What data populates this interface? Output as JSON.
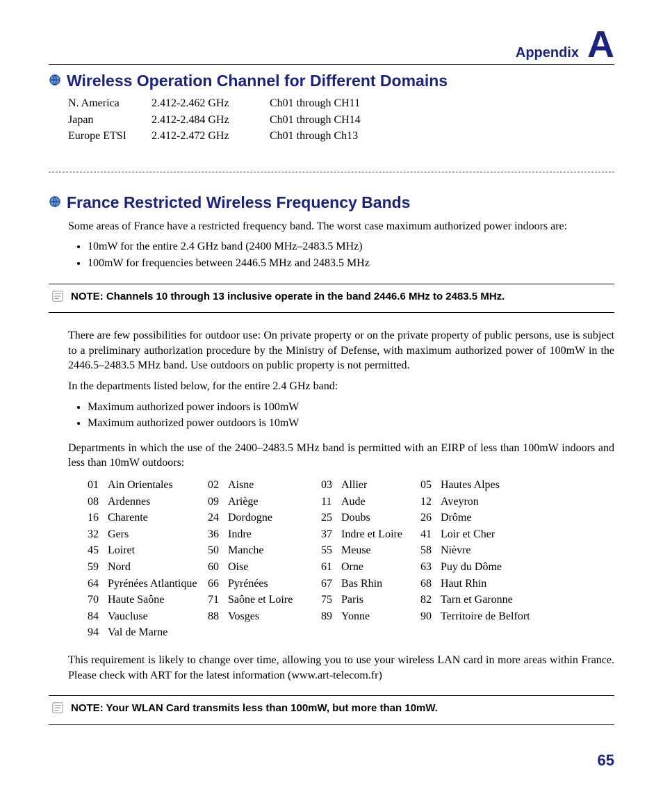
{
  "header": {
    "label": "Appendix",
    "letter": "A"
  },
  "section1": {
    "title": "Wireless Operation Channel for Different Domains",
    "rows": [
      {
        "region": "N. America",
        "freq": "2.412-2.462 GHz",
        "ch": "Ch01 through CH11"
      },
      {
        "region": "Japan",
        "freq": "2.412-2.484 GHz",
        "ch": "Ch01 through CH14"
      },
      {
        "region": "Europe ETSI",
        "freq": "2.412-2.472 GHz",
        "ch": "Ch01 through Ch13"
      }
    ]
  },
  "section2": {
    "title": "France Restricted Wireless Frequency Bands",
    "intro": "Some areas of France have a restricted frequency band. The worst case maximum authorized power indoors are:",
    "intro_bullets": [
      "10mW for the entire 2.4 GHz band (2400 MHz–2483.5 MHz)",
      "100mW for frequencies between 2446.5 MHz and 2483.5 MHz"
    ],
    "note1": "NOTE: Channels 10 through 13 inclusive operate in the band 2446.6 MHz to 2483.5 MHz.",
    "para1": "There are few possibilities for outdoor use: On private property or on the private property of public persons, use is subject to a preliminary authorization procedure by the Ministry of Defense, with maximum authorized power of 100mW in the 2446.5–2483.5 MHz band. Use outdoors on public property is not permitted.",
    "para2": "In the departments listed below, for the entire 2.4 GHz band:",
    "para2_bullets": [
      "Maximum authorized power indoors is 100mW",
      "Maximum authorized power outdoors is 10mW"
    ],
    "para3": "Departments in which the use of the 2400–2483.5 MHz band is permitted with an EIRP of less than 100mW indoors and less than 10mW outdoors:",
    "departments": [
      [
        "01",
        "Ain Orientales",
        "02",
        "Aisne",
        "03",
        "Allier",
        "05",
        "Hautes Alpes"
      ],
      [
        "08",
        "Ardennes",
        "09",
        "Ariège",
        "11",
        "Aude",
        "12",
        "Aveyron"
      ],
      [
        "16",
        "Charente",
        "24",
        "Dordogne",
        "25",
        "Doubs",
        "26",
        "Drôme"
      ],
      [
        "32",
        "Gers",
        "36",
        "Indre",
        "37",
        "Indre et Loire",
        "41",
        "Loir et Cher"
      ],
      [
        "45",
        "Loiret",
        "50",
        "Manche",
        "55",
        "Meuse",
        "58",
        "Nièvre"
      ],
      [
        "59",
        "Nord",
        "60",
        "Oise",
        "61",
        "Orne",
        "63",
        "Puy du Dôme"
      ],
      [
        "64",
        "Pyrénées Atlantique",
        "66",
        "Pyrénées",
        "67",
        "Bas Rhin",
        "68",
        "Haut Rhin"
      ],
      [
        "70",
        "Haute Saône",
        "71",
        "Saône et Loire",
        "75",
        "Paris",
        "82",
        "Tarn et Garonne"
      ],
      [
        "84",
        "Vaucluse",
        "88",
        "Vosges",
        "89",
        "Yonne",
        "90",
        "Territoire de Belfort"
      ],
      [
        "94",
        "Val de Marne",
        "",
        "",
        "",
        "",
        "",
        ""
      ]
    ],
    "para4": "This requirement is likely to change over time, allowing you to use your wireless LAN card in more areas within France. Please check with ART for the latest information (www.art-telecom.fr)",
    "note2": "NOTE: Your WLAN Card transmits less than 100mW, but more than 10mW."
  },
  "page_number": "65"
}
